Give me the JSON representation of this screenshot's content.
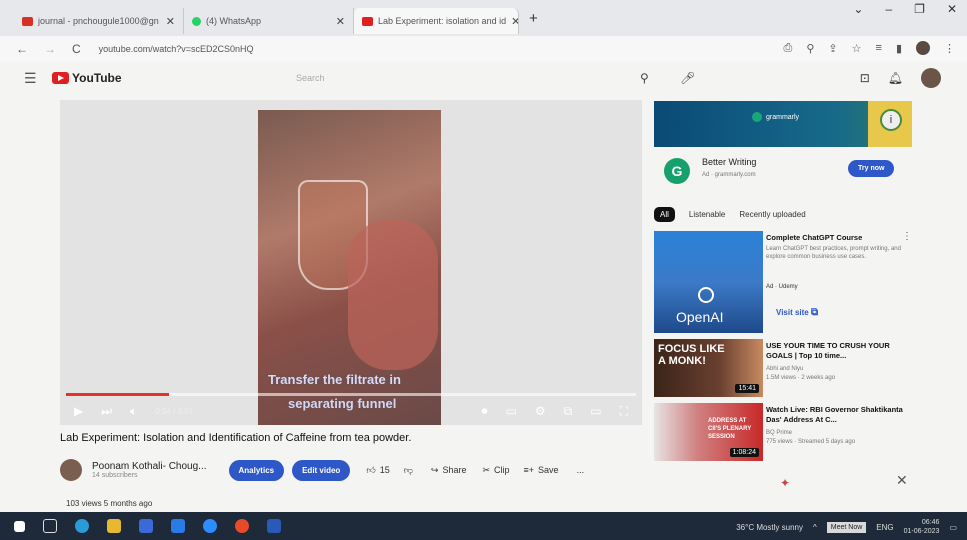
{
  "browser": {
    "tabs": [
      {
        "label": "journal - pnchougule1000@gn",
        "icon": "gmail-icon",
        "color": "#d93025"
      },
      {
        "label": "(4) WhatsApp",
        "icon": "whatsapp-icon",
        "color": "#25d366"
      },
      {
        "label": "Lab Experiment: isolation and id",
        "icon": "youtube-icon",
        "color": "#e02020"
      }
    ],
    "new_tab": "+",
    "url": "youtube.com/watch?v=scED2CS0nHQ"
  },
  "youtube": {
    "logo_text": "YouTube",
    "search_placeholder": "Search"
  },
  "player": {
    "caption_line1": "Transfer the filtrate in",
    "caption_line2": "separating funnel",
    "time": "0:34 / 3:07",
    "progress": 0.18
  },
  "video": {
    "title": "Lab Experiment: Isolation and Identification of Caffeine from tea powder.",
    "channel": "Poonam Kothali- Choug...",
    "subscribers": "14 subscribers",
    "analytics": "Analytics",
    "edit_video": "Edit video",
    "likes": "15",
    "share": "Share",
    "clip": "Clip",
    "save": "Save",
    "more": "...",
    "views": "103 views  5 months ago"
  },
  "ad": {
    "brand": "grammarly",
    "title": "Better Writing",
    "sub": "Ad · grammarly.com",
    "cta": "Try now"
  },
  "chips": [
    "All",
    "Listenable",
    "Recently uploaded"
  ],
  "recommendations": [
    {
      "title": "Complete ChatGPT Course",
      "meta": "Learn ChatGPT best practices, prompt writing, and explore common business use cases.",
      "meta2": "Ad · Udemy",
      "thumb_text": "OpenAI",
      "cta": "Visit site"
    },
    {
      "title": "USE YOUR TIME TO CRUSH YOUR GOALS | Top 10 time...",
      "meta": "Abhi and Niyu",
      "meta2": "1.5M views · 2 weeks ago",
      "thumb_text": "FOCUS LIKE A MONK!",
      "duration": "15:41"
    },
    {
      "title": "Watch Live: RBI Governor Shaktikanta Das' Address At C...",
      "meta": "BQ Prime",
      "meta2": "775 views · Streamed 5 days ago",
      "thumb_text": "ADDRESS AT CII'S PLENARY SESSION",
      "duration": "1:08:24"
    }
  ],
  "taskbar": {
    "weather": "36°C  Mostly sunny",
    "meet_now": "Meet Now",
    "lang": "ENG",
    "time": "06:46",
    "date": "01-06-2023"
  }
}
